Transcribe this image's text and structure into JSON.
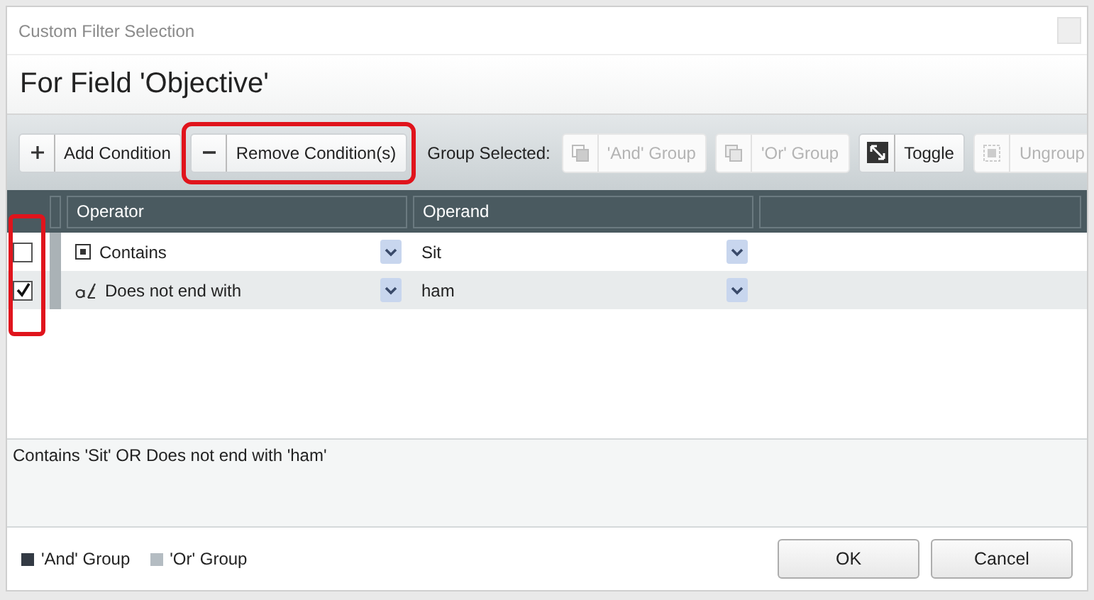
{
  "window": {
    "title": "Custom Filter Selection"
  },
  "heading": "For Field 'Objective'",
  "toolbar": {
    "buttons": [
      {
        "kind": "plus",
        "label": "Add Condition",
        "disabled": false
      },
      {
        "kind": "minus",
        "label": "Remove Condition(s)",
        "disabled": false,
        "highlighted": true
      }
    ],
    "group_label": "Group Selected:",
    "group_buttons": [
      {
        "kind": "and-group",
        "label": "'And' Group",
        "disabled": true
      },
      {
        "kind": "or-group",
        "label": "'Or' Group",
        "disabled": true
      },
      {
        "kind": "toggle",
        "label": "Toggle",
        "disabled": false
      },
      {
        "kind": "ungroup",
        "label": "Ungroup",
        "disabled": true
      }
    ]
  },
  "table": {
    "columns": [
      "Operator",
      "Operand"
    ],
    "checkbox_column_highlighted": true,
    "rows": [
      {
        "checked": false,
        "kind": "contains",
        "operator": "Contains",
        "operand": "Sit"
      },
      {
        "checked": true,
        "kind": "not-ends-with",
        "operator": "Does not end with",
        "operand": "ham"
      }
    ]
  },
  "summary": "Contains 'Sit' OR Does not end with 'ham'",
  "legend": [
    {
      "label": "'And' Group",
      "color": "#333a44"
    },
    {
      "label": "'Or' Group",
      "color": "#b4bcc2"
    }
  ],
  "buttons": [
    "OK",
    "Cancel"
  ]
}
